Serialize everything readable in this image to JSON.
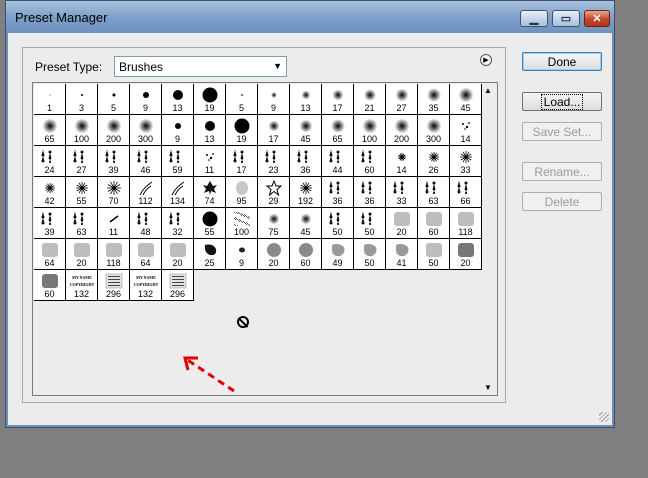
{
  "window": {
    "title": "Preset Manager"
  },
  "preset_type": {
    "label": "Preset Type:",
    "value": "Brushes"
  },
  "buttons": {
    "done": "Done",
    "load": "Load...",
    "save_set": "Save Set...",
    "rename": "Rename...",
    "delete": "Delete"
  },
  "brushes": [
    {
      "label": "1",
      "kind": "dot",
      "size": 1
    },
    {
      "label": "3",
      "kind": "dot",
      "size": 2
    },
    {
      "label": "5",
      "kind": "dot",
      "size": 3
    },
    {
      "label": "9",
      "kind": "dot",
      "size": 6
    },
    {
      "label": "13",
      "kind": "dot",
      "size": 10
    },
    {
      "label": "19",
      "kind": "dot",
      "size": 15
    },
    {
      "label": "5",
      "kind": "soft",
      "size": 3
    },
    {
      "label": "9",
      "kind": "soft",
      "size": 6
    },
    {
      "label": "13",
      "kind": "soft",
      "size": 9
    },
    {
      "label": "17",
      "kind": "soft",
      "size": 11
    },
    {
      "label": "21",
      "kind": "soft",
      "size": 12
    },
    {
      "label": "27",
      "kind": "soft",
      "size": 13
    },
    {
      "label": "35",
      "kind": "soft",
      "size": 14
    },
    {
      "label": "45",
      "kind": "soft",
      "size": 15
    },
    {
      "label": "65",
      "kind": "soft",
      "size": 15
    },
    {
      "label": "100",
      "kind": "soft",
      "size": 15
    },
    {
      "label": "200",
      "kind": "soft",
      "size": 15
    },
    {
      "label": "300",
      "kind": "soft",
      "size": 15
    },
    {
      "label": "9",
      "kind": "dot",
      "size": 6
    },
    {
      "label": "13",
      "kind": "dot",
      "size": 10
    },
    {
      "label": "19",
      "kind": "dot",
      "size": 15
    },
    {
      "label": "17",
      "kind": "soft",
      "size": 11
    },
    {
      "label": "45",
      "kind": "soft",
      "size": 13
    },
    {
      "label": "65",
      "kind": "soft",
      "size": 14
    },
    {
      "label": "100",
      "kind": "soft",
      "size": 15
    },
    {
      "label": "200",
      "kind": "soft",
      "size": 15
    },
    {
      "label": "300",
      "kind": "soft",
      "size": 15
    },
    {
      "label": "14",
      "kind": "scatter",
      "size": 10
    },
    {
      "label": "24",
      "kind": "texture",
      "size": 14
    },
    {
      "label": "27",
      "kind": "texture",
      "size": 14
    },
    {
      "label": "39",
      "kind": "texture",
      "size": 14
    },
    {
      "label": "46",
      "kind": "texture",
      "size": 14
    },
    {
      "label": "59",
      "kind": "texture",
      "size": 14
    },
    {
      "label": "11",
      "kind": "scatter",
      "size": 8
    },
    {
      "label": "17",
      "kind": "texture",
      "size": 12
    },
    {
      "label": "23",
      "kind": "texture",
      "size": 14
    },
    {
      "label": "36",
      "kind": "texture",
      "size": 14
    },
    {
      "label": "44",
      "kind": "texture",
      "size": 14
    },
    {
      "label": "60",
      "kind": "texture",
      "size": 14
    },
    {
      "label": "14",
      "kind": "star",
      "size": 8
    },
    {
      "label": "26",
      "kind": "star",
      "size": 10
    },
    {
      "label": "33",
      "kind": "star",
      "size": 12
    },
    {
      "label": "42",
      "kind": "star",
      "size": 10
    },
    {
      "label": "55",
      "kind": "star",
      "size": 12
    },
    {
      "label": "70",
      "kind": "star",
      "size": 14
    },
    {
      "label": "112",
      "kind": "grass",
      "size": 14
    },
    {
      "label": "134",
      "kind": "grass",
      "size": 14
    },
    {
      "label": "74",
      "kind": "leaf",
      "size": 14
    },
    {
      "label": "95",
      "kind": "leafgray",
      "size": 14
    },
    {
      "label": "29",
      "kind": "staroutline",
      "size": 14
    },
    {
      "label": "192",
      "kind": "star",
      "size": 12
    },
    {
      "label": "36",
      "kind": "texture",
      "size": 14
    },
    {
      "label": "36",
      "kind": "texture",
      "size": 14
    },
    {
      "label": "33",
      "kind": "texture",
      "size": 14
    },
    {
      "label": "63",
      "kind": "texture",
      "size": 14
    },
    {
      "label": "66",
      "kind": "texture",
      "size": 14
    },
    {
      "label": "39",
      "kind": "texture",
      "size": 14
    },
    {
      "label": "63",
      "kind": "texture",
      "size": 14
    },
    {
      "label": "11",
      "kind": "stroke",
      "size": 8
    },
    {
      "label": "48",
      "kind": "texture",
      "size": 14
    },
    {
      "label": "32",
      "kind": "texture",
      "size": 14
    },
    {
      "label": "55",
      "kind": "dot",
      "size": 15
    },
    {
      "label": "100",
      "kind": "noise",
      "size": 15
    },
    {
      "label": "75",
      "kind": "soft",
      "size": 11
    },
    {
      "label": "45",
      "kind": "soft",
      "size": 11
    },
    {
      "label": "50",
      "kind": "texture",
      "size": 14
    },
    {
      "label": "50",
      "kind": "texture",
      "size": 14
    },
    {
      "label": "20",
      "kind": "gray",
      "size": 15
    },
    {
      "label": "60",
      "kind": "gray",
      "size": 15
    },
    {
      "label": "118",
      "kind": "gray",
      "size": 15
    },
    {
      "label": "64",
      "kind": "gray",
      "size": 15
    },
    {
      "label": "20",
      "kind": "gray",
      "size": 15
    },
    {
      "label": "118",
      "kind": "gray",
      "size": 15
    },
    {
      "label": "64",
      "kind": "gray",
      "size": 15
    },
    {
      "label": "20",
      "kind": "gray",
      "size": 15
    },
    {
      "label": "25",
      "kind": "blob",
      "size": 14
    },
    {
      "label": "9",
      "kind": "smalldark",
      "size": 6
    },
    {
      "label": "20",
      "kind": "grayround",
      "size": 14
    },
    {
      "label": "60",
      "kind": "grayround",
      "size": 14
    },
    {
      "label": "49",
      "kind": "graysplash",
      "size": 14
    },
    {
      "label": "50",
      "kind": "graysplash",
      "size": 14
    },
    {
      "label": "41",
      "kind": "graysplash",
      "size": 14
    },
    {
      "label": "50",
      "kind": "gray",
      "size": 15
    },
    {
      "label": "20",
      "kind": "graydark",
      "size": 15
    },
    {
      "label": "60",
      "kind": "graydark",
      "size": 15
    },
    {
      "label": "132",
      "kind": "text",
      "size": 14,
      "text": "MY NAME COPYRIGHT"
    },
    {
      "label": "296",
      "kind": "textbox",
      "size": 14
    },
    {
      "label": "132",
      "kind": "text",
      "size": 14,
      "text": "MY NAME COPYRIGHT"
    },
    {
      "label": "296",
      "kind": "textbox",
      "size": 14
    }
  ]
}
